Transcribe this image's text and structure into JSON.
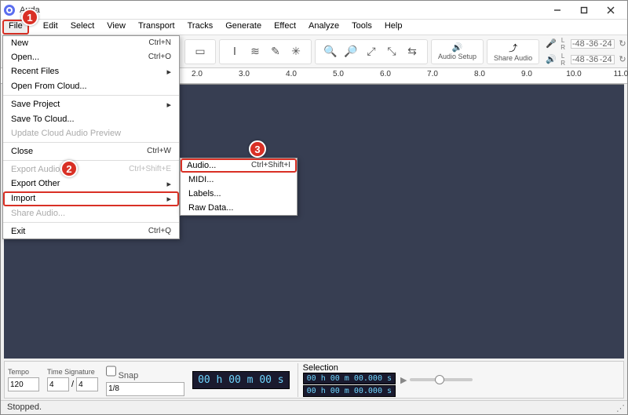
{
  "titlebar": {
    "title": "Auda"
  },
  "menubar": [
    "File",
    "Edit",
    "Select",
    "View",
    "Transport",
    "Tracks",
    "Generate",
    "Effect",
    "Analyze",
    "Tools",
    "Help"
  ],
  "toolbar": {
    "audio_setup": "Audio Setup",
    "share_audio": "Share Audio",
    "meter_labels": [
      "-48",
      "-36",
      "-24",
      ""
    ]
  },
  "ruler": {
    "ticks": [
      "2.0",
      "3.0",
      "4.0",
      "5.0",
      "6.0",
      "7.0",
      "8.0",
      "9.0",
      "10.0",
      "11.0"
    ]
  },
  "file_menu": {
    "new": {
      "label": "New",
      "accel": "Ctrl+N"
    },
    "open": {
      "label": "Open...",
      "accel": "Ctrl+O"
    },
    "recent": {
      "label": "Recent Files",
      "arrow": "▸"
    },
    "openCloud": {
      "label": "Open From Cloud..."
    },
    "saveProject": {
      "label": "Save Project",
      "arrow": "▸"
    },
    "saveToCloud": {
      "label": "Save To Cloud..."
    },
    "updateCloud": {
      "label": "Update Cloud Audio Preview"
    },
    "close": {
      "label": "Close",
      "accel": "Ctrl+W"
    },
    "exportAudio": {
      "label": "Export Audio...",
      "accel": "Ctrl+Shift+E"
    },
    "exportOther": {
      "label": "Export Other",
      "arrow": "▸"
    },
    "import": {
      "label": "Import",
      "arrow": "▸"
    },
    "shareAudio": {
      "label": "Share Audio..."
    },
    "exit": {
      "label": "Exit",
      "accel": "Ctrl+Q"
    }
  },
  "import_submenu": {
    "audio": {
      "label": "Audio...",
      "accel": "Ctrl+Shift+I"
    },
    "midi": {
      "label": "MIDI..."
    },
    "labels": {
      "label": "Labels..."
    },
    "rawdata": {
      "label": "Raw Data..."
    }
  },
  "bottom": {
    "tempo_label": "Tempo",
    "tempo_value": "120",
    "timesig_label": "Time Signature",
    "timesig_num": "4",
    "timesig_sep": "/",
    "timesig_den": "4",
    "snap_label": "Snap",
    "snap_value": "1/8",
    "timecode": "00 h 00 m 00 s",
    "selection_label": "Selection",
    "sel_start": "00 h 00 m 00.000 s",
    "sel_end": "00 h 00 m 00.000 s"
  },
  "status": {
    "text": "Stopped."
  },
  "badges": {
    "b1": "1",
    "b2": "2",
    "b3": "3"
  }
}
